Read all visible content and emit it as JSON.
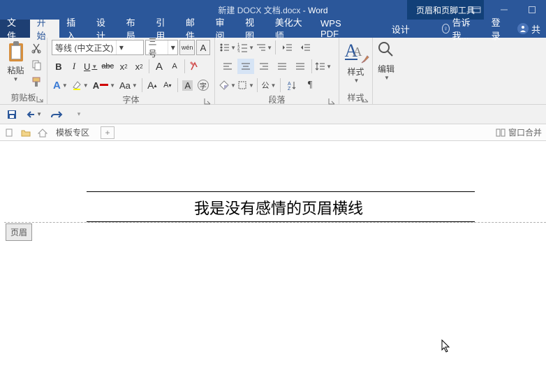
{
  "title": {
    "doc": "新建 DOCX 文档.docx",
    "app": "Word"
  },
  "contextual_tool": "页眉和页脚工具",
  "tabs": {
    "file": "文件",
    "home": "开始",
    "insert": "插入",
    "design": "设计",
    "layout": "布局",
    "references": "引用",
    "mailings": "邮件",
    "review": "审阅",
    "view": "视图",
    "beautify": "美化大师",
    "wpspdf": "WPS PDF",
    "context_design": "设计",
    "tell_me": "告诉我...",
    "login": "登录",
    "share": "共"
  },
  "ribbon": {
    "clipboard": {
      "label": "剪贴板",
      "paste": "粘贴"
    },
    "font": {
      "label": "字体",
      "name": "等线 (中文正文)",
      "size": "三号",
      "wen": "wén",
      "bold": "B",
      "italic": "I",
      "underline": "U",
      "strike": "abc",
      "sub": "x",
      "sup": "x",
      "A_big": "A",
      "A_small": "A"
    },
    "paragraph": {
      "label": "段落"
    },
    "styles": {
      "label": "样式"
    },
    "editing": {
      "label": "编辑"
    }
  },
  "doctabs": {
    "template_zone": "模板专区",
    "window_merge": "窗口合并"
  },
  "page": {
    "header_text": "我是没有感情的页眉横线",
    "header_tag": "页眉"
  }
}
